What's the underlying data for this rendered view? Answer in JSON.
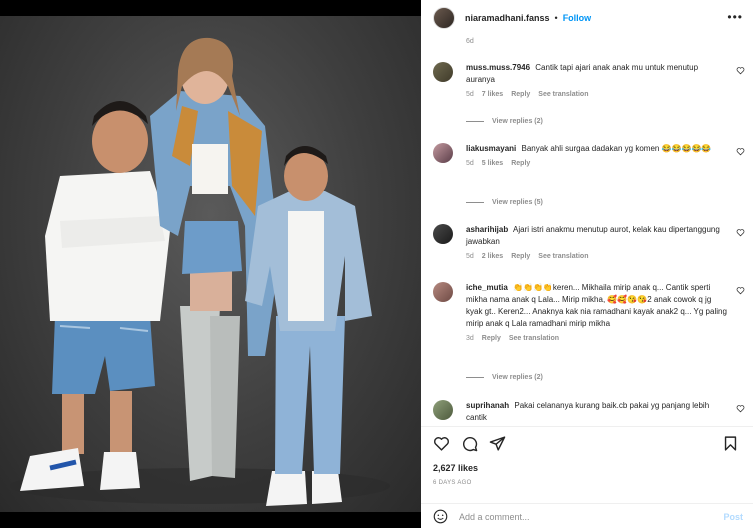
{
  "post": {
    "username": "niaramadhani.fanss",
    "follow_label": "Follow",
    "more_label": "•••",
    "separator": "•"
  },
  "comments_section": {
    "previous_time": "6d",
    "view_replies": [
      "View replies (2)",
      "View replies (5)",
      "View replies (2)"
    ],
    "comments": [
      {
        "username": "muss.muss.7946",
        "text": "Cantik tapi ajari anak anak mu untuk menutup auranya",
        "time": "5d",
        "likes": "7 likes",
        "reply": "Reply",
        "translation": "See translation"
      },
      {
        "username": "liakusmayani",
        "text": "Banyak ahli surgaa dadakan yg komen 😂😂😂😂😂",
        "time": "5d",
        "likes": "5 likes",
        "reply": "Reply",
        "translation": ""
      },
      {
        "username": "asharihijab",
        "text": "Ajari istri anakmu menutup aurot, kelak kau dipertanggung jawabkan",
        "time": "5d",
        "likes": "2 likes",
        "reply": "Reply",
        "translation": "See translation"
      },
      {
        "username": "iche_mutia",
        "text": "👏👏👏👏keren... Mikhaila mirip anak q... Cantik sperti mikha nama anak q Lala... Mirip mikha, 🥰🥰😘😘2 anak cowok q jg kyak gt.. Keren2... Anaknya kak nia ramadhani kayak anak2 q... Yg paling mirip anak q Lala ramadhani mirip mikha",
        "time": "3d",
        "likes": "",
        "reply": "Reply",
        "translation": "See translation"
      },
      {
        "username": "suprihanah",
        "text": "Pakai celananya kurang baik.cb pakai yg panjang lebih cantik",
        "time": "",
        "likes": "",
        "reply": "",
        "translation": ""
      }
    ]
  },
  "footer": {
    "likes": "2,627 likes",
    "date": "6 DAYS AGO",
    "comment_placeholder": "Add a comment...",
    "post_label": "Post"
  },
  "colors": {
    "accent": "#0095f6",
    "post_disabled": "#b3dbff",
    "muted": "#8e8e8e"
  }
}
